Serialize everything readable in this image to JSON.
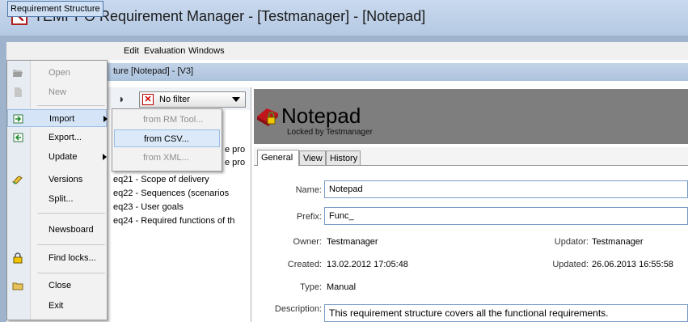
{
  "window": {
    "title": "TEMPPO Requirement Manager - [Testmanager] - [Notepad]"
  },
  "menubar": [
    "Requirement Structure",
    "Edit",
    "Evaluation",
    "Windows"
  ],
  "inner_window": {
    "title_suffix": "ture [Notepad] - [V3]"
  },
  "filter": {
    "selected": "No filter"
  },
  "tree": {
    "items": [
      "e pro",
      "e pro",
      "eq21 - Scope of delivery",
      "eq22 - Sequences (scenarios",
      "eq23 - User goals",
      "eq24 - Required functions of th"
    ]
  },
  "dropdown": {
    "open": "Open",
    "new": "New",
    "import": "Import",
    "export": "Export...",
    "update": "Update",
    "versions": "Versions",
    "split": "Split...",
    "newsboard": "Newsboard",
    "find_locks": "Find locks...",
    "close": "Close",
    "exit": "Exit"
  },
  "import_submenu": [
    "from RM Tool...",
    "from CSV...",
    "from XML..."
  ],
  "detail": {
    "title": "Notepad",
    "locked": "Locked by Testmanager",
    "tabs": [
      "General",
      "View",
      "History"
    ],
    "name_label": "Name:",
    "name_value": "Notepad",
    "prefix_label": "Prefix:",
    "prefix_value": "Func_",
    "owner_label": "Owner:",
    "owner_value": "Testmanager",
    "updator_label": "Updator:",
    "updator_value": "Testmanager",
    "created_label": "Created:",
    "created_value": "13.02.2012 17:05:48",
    "updated_label": "Updated:",
    "updated_value": "26.06.2013 16:55:58",
    "type_label": "Type:",
    "type_value": "Manual",
    "description_label": "Description:",
    "description_value": "This requirement structure covers all the functional requirements."
  },
  "colors": {
    "accent": "#4d77a8",
    "header_band": "#7e7e7e",
    "menu_highlight": "#d5e5f7"
  }
}
